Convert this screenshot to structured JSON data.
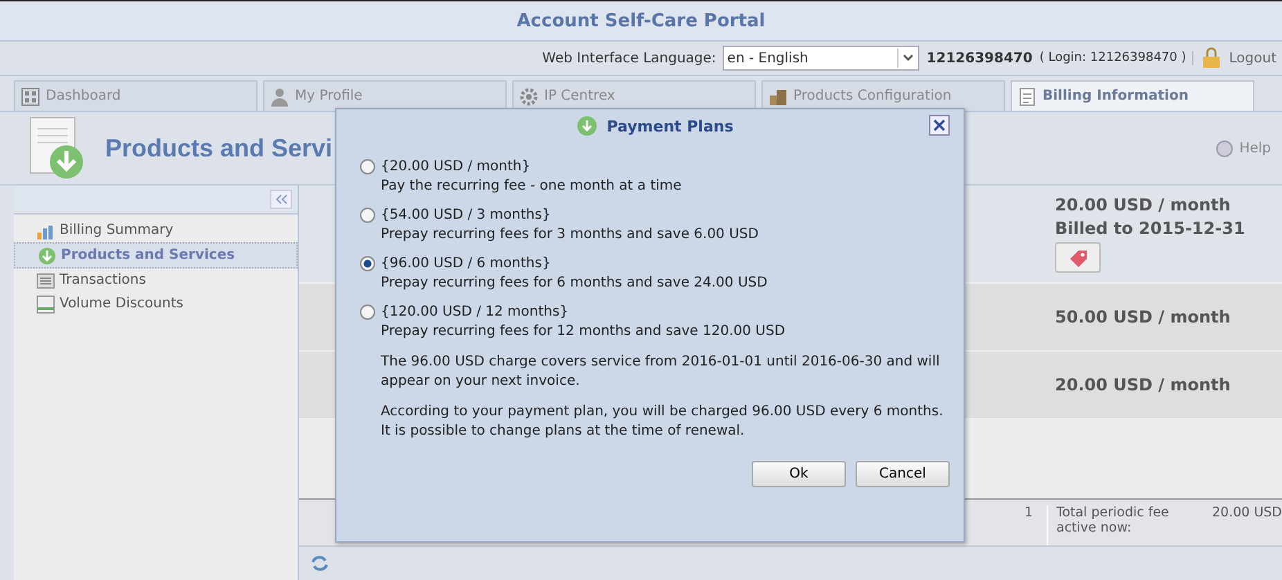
{
  "window": {
    "title": "Account Self-Care Portal"
  },
  "top_bar": {
    "language_label": "Web Interface Language:",
    "language_value": "en - English",
    "account": "12126398470",
    "login_text": "( Login: 12126398470 )",
    "logout": "Logout"
  },
  "tabs": [
    {
      "label": "Dashboard",
      "selected": false
    },
    {
      "label": "My Profile",
      "selected": false
    },
    {
      "label": "IP Centrex",
      "selected": false
    },
    {
      "label": "Products Configuration",
      "selected": false
    },
    {
      "label": "Billing Information",
      "selected": true
    }
  ],
  "header": {
    "title": "Products and Servi",
    "help": "Help"
  },
  "sidebar": {
    "items": [
      {
        "label": "Billing Summary",
        "selected": false
      },
      {
        "label": "Products and Services",
        "selected": true
      },
      {
        "label": "Transactions",
        "selected": false
      },
      {
        "label": "Volume Discounts",
        "selected": false
      }
    ]
  },
  "rows": [
    {
      "fee": "20.00 USD / month",
      "billed": "Billed to 2015-12-31",
      "has_tag_button": true
    },
    {
      "fee": "50.00 USD / month",
      "has_tag_button": false
    },
    {
      "fee": "20.00 USD / month",
      "has_tag_button": false
    }
  ],
  "footer": {
    "count": "1",
    "label": "Total periodic fee active now:",
    "total": "20.00 USD"
  },
  "dialog": {
    "title": "Payment Plans",
    "plans": [
      {
        "name": "{20.00 USD / month}",
        "description": "Pay the recurring fee - one month at a time",
        "selected": false
      },
      {
        "name": "{54.00 USD / 3 months}",
        "description": "Prepay recurring fees for 3 months and save 6.00 USD",
        "selected": false
      },
      {
        "name": "{96.00 USD / 6 months}",
        "description": "Prepay recurring fees for 6 months and save 24.00 USD",
        "selected": true
      },
      {
        "name": "{120.00 USD / 12 months}",
        "description": "Prepay recurring fees for 12 months and save 120.00 USD",
        "selected": false
      }
    ],
    "notes": [
      "The 96.00 USD charge covers service from 2016-01-01 until 2016-06-30 and will appear on your next invoice.",
      "According to your payment plan, you will be charged 96.00 USD every 6 months. It is possible to change plans at the time of renewal."
    ],
    "buttons": [
      "Ok",
      "Cancel"
    ]
  }
}
